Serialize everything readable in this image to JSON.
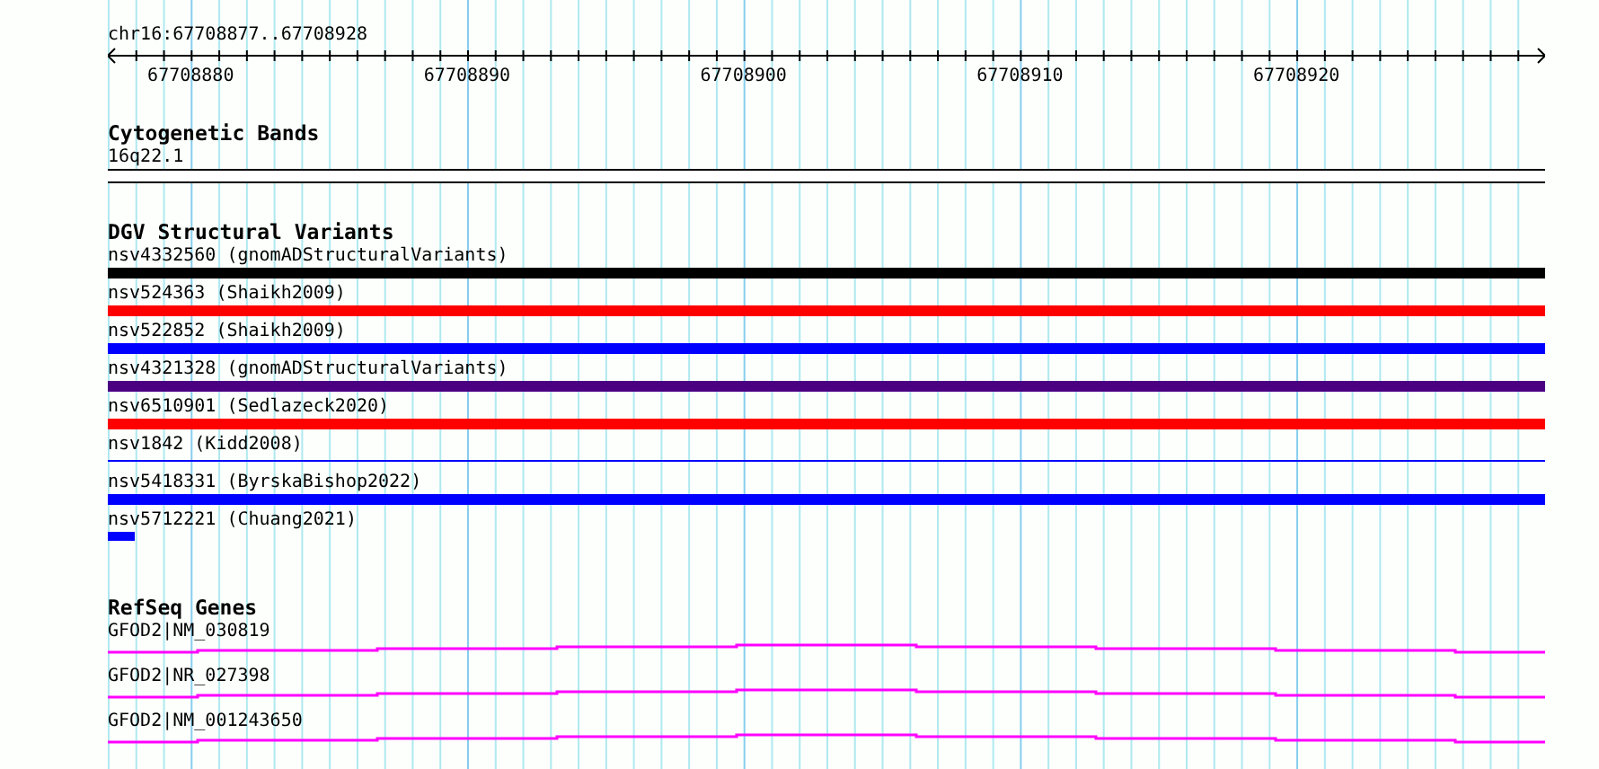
{
  "location": "chr16:67708877..67708928",
  "ruler": {
    "labels": [
      "67708880",
      "67708890",
      "67708900",
      "67708910",
      "67708920"
    ]
  },
  "cytogenetic_bands": {
    "title": "Cytogenetic Bands",
    "features": [
      {
        "label": "16q22.1"
      }
    ]
  },
  "dgv_structural_variants": {
    "title": "DGV Structural Variants",
    "features": [
      {
        "label": "nsv4332560 (gnomADStructuralVariants)",
        "color": "#000000",
        "kind": "bar"
      },
      {
        "label": "nsv524363 (Shaikh2009)",
        "color": "#ff0000",
        "kind": "bar"
      },
      {
        "label": "nsv522852 (Shaikh2009)",
        "color": "#0000ff",
        "kind": "bar"
      },
      {
        "label": "nsv4321328 (gnomADStructuralVariants)",
        "color": "#4b0082",
        "kind": "bar"
      },
      {
        "label": "nsv6510901 (Sedlazeck2020)",
        "color": "#ff0000",
        "kind": "bar"
      },
      {
        "label": "nsv1842 (Kidd2008)",
        "color": "#0000ff",
        "kind": "line"
      },
      {
        "label": "nsv5418331 (ByrskaBishop2022)",
        "color": "#0000ff",
        "kind": "bar"
      },
      {
        "label": "nsv5712221 (Chuang2021)",
        "color": "#0000ff",
        "kind": "stub"
      }
    ]
  },
  "refseq_genes": {
    "title": "RefSeq Genes",
    "features": [
      {
        "label": "GFOD2|NM_030819"
      },
      {
        "label": "GFOD2|NR_027398"
      },
      {
        "label": "GFOD2|NM_001243650"
      }
    ]
  }
}
